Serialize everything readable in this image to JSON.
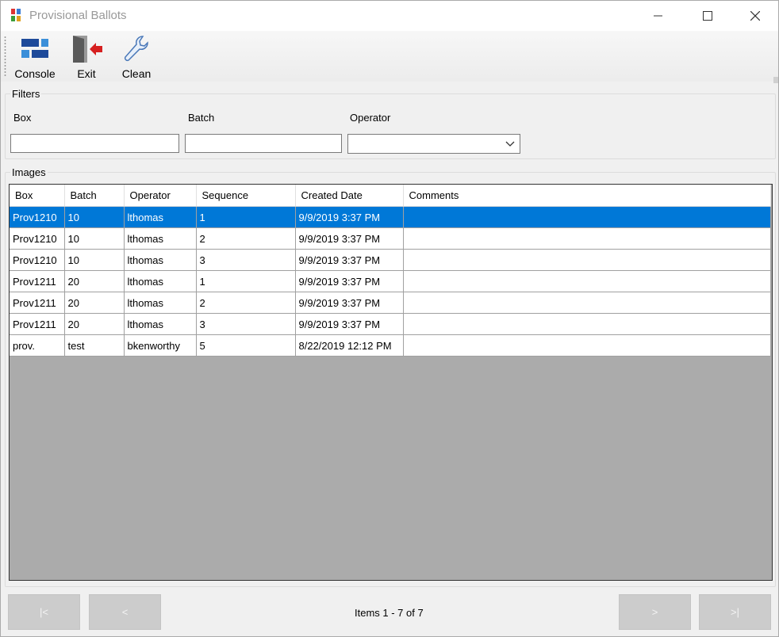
{
  "window": {
    "title": "Provisional Ballots"
  },
  "toolbar": {
    "items": [
      {
        "label": "Console",
        "icon": "console-icon"
      },
      {
        "label": "Exit",
        "icon": "exit-icon"
      },
      {
        "label": "Clean",
        "icon": "wrench-icon"
      }
    ]
  },
  "filters": {
    "legend": "Filters",
    "box_label": "Box",
    "batch_label": "Batch",
    "operator_label": "Operator",
    "box_value": "",
    "batch_value": "",
    "operator_value": ""
  },
  "images": {
    "legend": "Images",
    "columns": [
      "Box",
      "Batch",
      "Operator",
      "Sequence",
      "Created Date",
      "Comments"
    ],
    "rows": [
      [
        "Prov1210",
        "10",
        "lthomas",
        "1",
        "9/9/2019 3:37 PM",
        ""
      ],
      [
        "Prov1210",
        "10",
        "lthomas",
        "2",
        "9/9/2019 3:37 PM",
        ""
      ],
      [
        "Prov1210",
        "10",
        "lthomas",
        "3",
        "9/9/2019 3:37 PM",
        ""
      ],
      [
        "Prov1211",
        "20",
        "lthomas",
        "1",
        "9/9/2019 3:37 PM",
        ""
      ],
      [
        "Prov1211",
        "20",
        "lthomas",
        "2",
        "9/9/2019 3:37 PM",
        ""
      ],
      [
        "Prov1211",
        "20",
        "lthomas",
        "3",
        "9/9/2019 3:37 PM",
        ""
      ],
      [
        "prov.",
        "test",
        "bkenworthy",
        "5",
        "8/22/2019 12:12 PM",
        ""
      ]
    ],
    "selected_row": 0
  },
  "pager": {
    "first_label": "|<",
    "prev_label": "<",
    "next_label": ">",
    "last_label": ">|",
    "status": "Items 1 - 7 of 7"
  },
  "colors": {
    "selection": "#0078d7",
    "grid_empty": "#ababab"
  }
}
